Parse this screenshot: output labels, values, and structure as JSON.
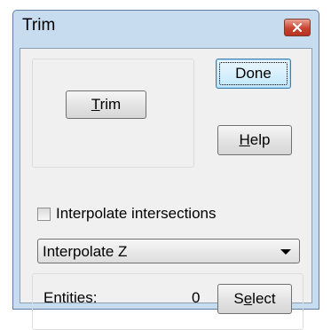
{
  "window": {
    "title": "Trim",
    "close_icon": "close-icon"
  },
  "buttons": {
    "trim_label": "Trim",
    "trim_mnemonic": "T",
    "done_label": "Done",
    "help_label": "Help",
    "help_mnemonic": "H",
    "select_label": "Select",
    "select_mnemonic": "e"
  },
  "options": {
    "interpolate_intersections_label": "Interpolate intersections",
    "interpolate_intersections_checked": false,
    "interpolate_mode_value": "Interpolate Z"
  },
  "entities": {
    "label": "Entities:",
    "count": "0"
  },
  "colors": {
    "title_bar": "#c8dcf0",
    "close_button": "#c8442f",
    "dialog_face": "#f0f0f0",
    "default_button_border": "#3c7fb1"
  }
}
